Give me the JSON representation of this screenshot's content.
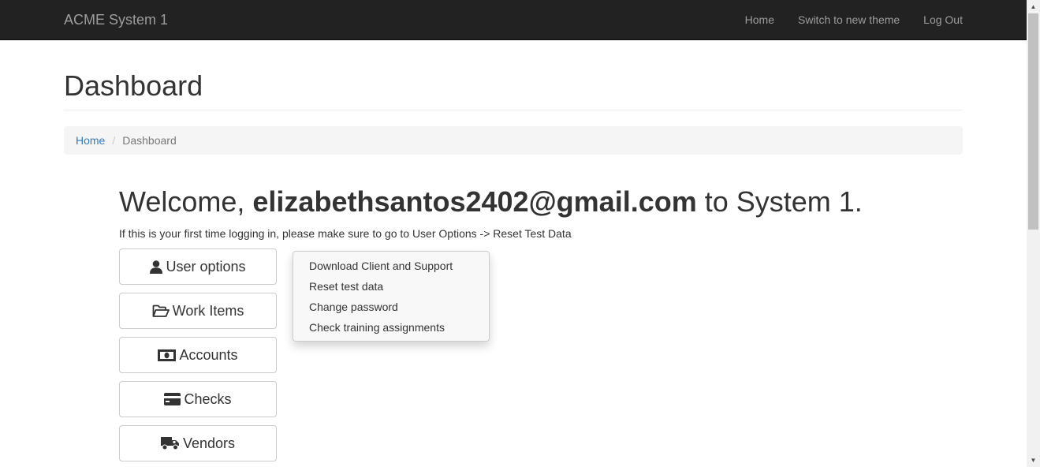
{
  "navbar": {
    "brand": "ACME System 1",
    "links": [
      "Home",
      "Switch to new theme",
      "Log Out"
    ]
  },
  "page": {
    "title": "Dashboard"
  },
  "breadcrumb": {
    "home": "Home",
    "current": "Dashboard"
  },
  "welcome": {
    "prefix": "Welcome,",
    "user": "elizabethsantos2402@gmail.com",
    "suffix": "to System 1.",
    "hint": "If this is your first time logging in, please make sure to go to User Options -> Reset Test Data"
  },
  "menu": [
    {
      "label": "User options",
      "icon": "user-icon"
    },
    {
      "label": "Work Items",
      "icon": "folder-open-icon"
    },
    {
      "label": "Accounts",
      "icon": "money-icon"
    },
    {
      "label": "Checks",
      "icon": "credit-card-icon"
    },
    {
      "label": "Vendors",
      "icon": "truck-icon"
    }
  ],
  "dropdown": {
    "items": [
      "Download Client and Support",
      "Reset test data",
      "Change password",
      "Check training assignments"
    ]
  },
  "colors": {
    "navbar_bg": "#222222",
    "link": "#337ab7",
    "breadcrumb_bg": "#f5f5f5"
  }
}
